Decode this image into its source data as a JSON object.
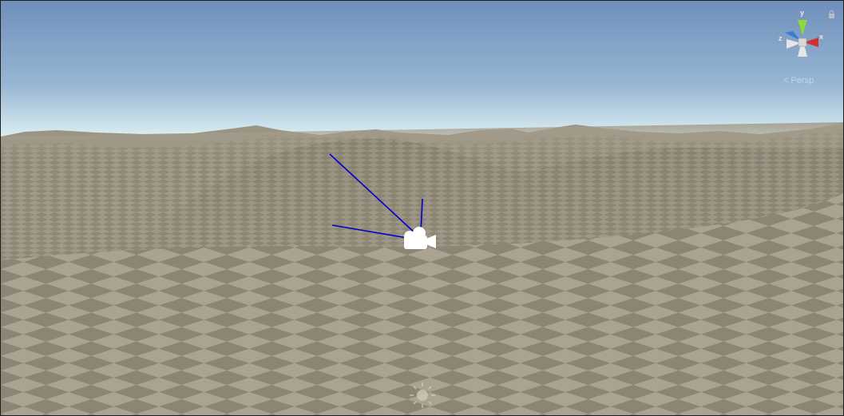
{
  "gizmo": {
    "axes": {
      "y": "y",
      "x": "x",
      "z": "z"
    },
    "projection_label": "< Persp",
    "colors": {
      "y": "#8dd93c",
      "x": "#d03232",
      "z": "#3a7bd5",
      "neutral": "#e6e6e6"
    }
  },
  "scene": {
    "sky_top": "#7594bd",
    "sky_horizon": "#e7f2f5",
    "ground_light": "#aaa290",
    "ground_dark": "#8d8674",
    "frustum_color": "#0000cc",
    "icons": [
      "camera-icon",
      "directional-light-icon"
    ]
  }
}
